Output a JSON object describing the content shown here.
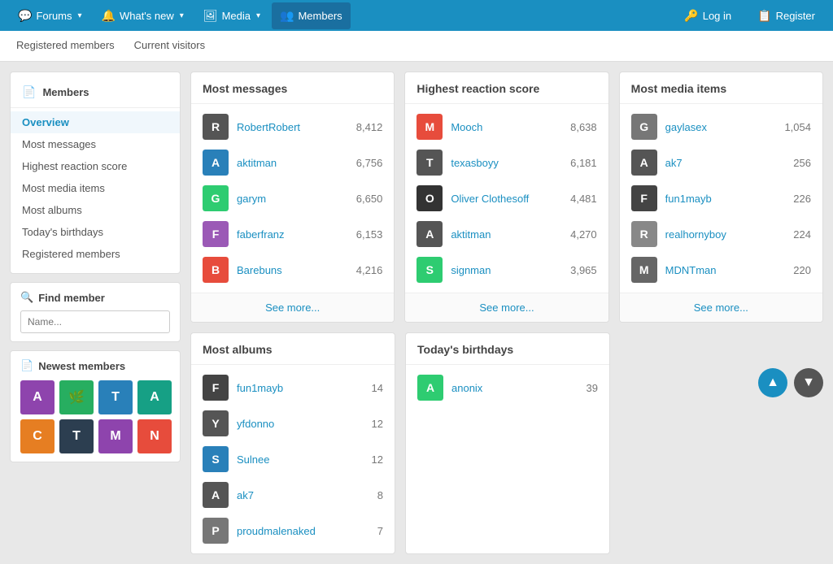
{
  "topNav": {
    "items": [
      {
        "id": "forums",
        "label": "Forums",
        "icon": "💬",
        "hasChevron": true
      },
      {
        "id": "whats-new",
        "label": "What's new",
        "icon": "🔔",
        "hasChevron": true
      },
      {
        "id": "media",
        "label": "Media",
        "icon": "🖼",
        "hasChevron": true
      },
      {
        "id": "members",
        "label": "Members",
        "icon": "👥",
        "hasChevron": false,
        "active": true
      }
    ],
    "right": [
      {
        "id": "login",
        "label": "Log in",
        "icon": "🔑"
      },
      {
        "id": "register",
        "label": "Register",
        "icon": "📋"
      }
    ]
  },
  "subNav": {
    "items": [
      {
        "id": "registered",
        "label": "Registered members"
      },
      {
        "id": "visitors",
        "label": "Current visitors"
      }
    ]
  },
  "sidebar": {
    "membersTitle": "Members",
    "menuItems": [
      {
        "id": "overview",
        "label": "Overview",
        "active": true
      },
      {
        "id": "most-messages",
        "label": "Most messages"
      },
      {
        "id": "highest-reaction",
        "label": "Highest reaction score"
      },
      {
        "id": "most-media",
        "label": "Most media items"
      },
      {
        "id": "most-albums",
        "label": "Most albums"
      },
      {
        "id": "birthdays",
        "label": "Today's birthdays"
      },
      {
        "id": "registered",
        "label": "Registered members"
      }
    ],
    "findMember": {
      "title": "Find member",
      "placeholder": "Name..."
    },
    "newestMembers": {
      "title": "Newest members",
      "avatars": [
        {
          "letter": "A",
          "color": "#8e44ad"
        },
        {
          "letter": "🌿",
          "color": "#27ae60",
          "isImage": true
        },
        {
          "letter": "T",
          "color": "#2980b9"
        },
        {
          "letter": "A",
          "color": "#16a085"
        },
        {
          "letter": "C",
          "color": "#e67e22"
        },
        {
          "letter": "T",
          "color": "#2c3e50"
        },
        {
          "letter": "M",
          "color": "#8e44ad"
        },
        {
          "letter": "N",
          "color": "#e74c3c"
        }
      ]
    }
  },
  "mostMessages": {
    "title": "Most messages",
    "items": [
      {
        "username": "RobertRobert",
        "count": "8,412",
        "avatarColor": "#555",
        "letter": "R"
      },
      {
        "username": "aktitman",
        "count": "6,756",
        "avatarColor": "#2980b9",
        "letter": "A"
      },
      {
        "username": "garym",
        "count": "6,650",
        "avatarColor": "#2ecc71",
        "letter": "G"
      },
      {
        "username": "faberfranz",
        "count": "6,153",
        "avatarColor": "#9b59b6",
        "letter": "F"
      },
      {
        "username": "Barebuns",
        "count": "4,216",
        "avatarColor": "#e74c3c",
        "letter": "B"
      }
    ],
    "seeMore": "See more..."
  },
  "highestReaction": {
    "title": "Highest reaction score",
    "items": [
      {
        "username": "Mooch",
        "count": "8,638",
        "avatarColor": "#e74c3c",
        "letter": "M"
      },
      {
        "username": "texasboyy",
        "count": "6,181",
        "avatarColor": "#555",
        "letter": "T"
      },
      {
        "username": "Oliver Clothesoff",
        "count": "4,481",
        "avatarColor": "#333",
        "letter": "O"
      },
      {
        "username": "aktitman",
        "count": "4,270",
        "avatarColor": "#555",
        "letter": "A"
      },
      {
        "username": "signman",
        "count": "3,965",
        "avatarColor": "#2ecc71",
        "letter": "S"
      }
    ],
    "seeMore": "See more..."
  },
  "mostMedia": {
    "title": "Most media items",
    "items": [
      {
        "username": "gaylasex",
        "count": "1,054",
        "avatarColor": "#777",
        "letter": "G"
      },
      {
        "username": "ak7",
        "count": "256",
        "avatarColor": "#555",
        "letter": "A"
      },
      {
        "username": "fun1mayb",
        "count": "226",
        "avatarColor": "#444",
        "letter": "F"
      },
      {
        "username": "realhornyboy",
        "count": "224",
        "avatarColor": "#888",
        "letter": "R"
      },
      {
        "username": "MDNTman",
        "count": "220",
        "avatarColor": "#666",
        "letter": "M"
      }
    ],
    "seeMore": "See more..."
  },
  "mostAlbums": {
    "title": "Most albums",
    "items": [
      {
        "username": "fun1mayb",
        "count": "14",
        "avatarColor": "#444",
        "letter": "F"
      },
      {
        "username": "yfdonno",
        "count": "12",
        "avatarColor": "#555",
        "letter": "Y"
      },
      {
        "username": "Sulnee",
        "count": "12",
        "avatarColor": "#2980b9",
        "letter": "S"
      },
      {
        "username": "ak7",
        "count": "8",
        "avatarColor": "#555",
        "letter": "A"
      },
      {
        "username": "proudmalenaked",
        "count": "7",
        "avatarColor": "#777",
        "letter": "P"
      }
    ]
  },
  "birthdays": {
    "title": "Today's birthdays",
    "items": [
      {
        "username": "anonix",
        "count": "39",
        "avatarColor": "#2ecc71",
        "letter": "A"
      }
    ]
  }
}
